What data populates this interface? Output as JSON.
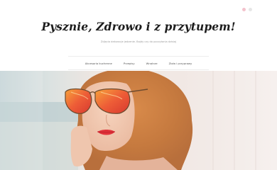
{
  "site": {
    "title": "Pysznie, Zdrowo i z przytupem!",
    "tagline": "Zdjęcia dekoracje jedzenie. Bajdy czy do poczytania dzisiaj"
  },
  "nav": {
    "items": [
      {
        "label": "Akcesoria kuchenne"
      },
      {
        "label": "Przepisy"
      },
      {
        "label": "Wnętrze"
      },
      {
        "label": "Zioła i przyprawy"
      }
    ]
  },
  "colors": {
    "accent": "#f3c2cc",
    "title": "#1c1c1c",
    "nav_text": "#555555"
  },
  "hero": {
    "icon": "woman-sunglasses-photo"
  }
}
